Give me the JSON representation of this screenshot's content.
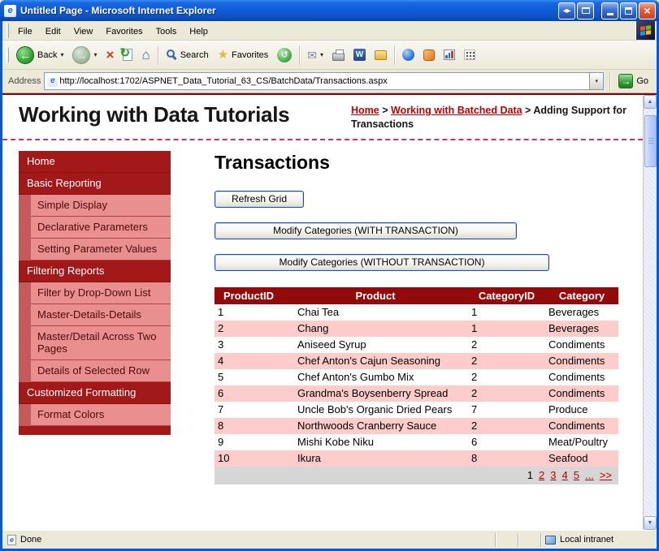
{
  "window": {
    "title": "Untitled Page - Microsoft Internet Explorer",
    "status_left": "Done",
    "status_right": "Local intranet"
  },
  "menu": {
    "items": [
      "File",
      "Edit",
      "View",
      "Favorites",
      "Tools",
      "Help"
    ]
  },
  "toolbar": {
    "back_label": "Back",
    "search_label": "Search",
    "favorites_label": "Favorites",
    "icons": [
      "back",
      "forward",
      "stop",
      "refresh",
      "home",
      "search",
      "favorites",
      "history",
      "mail",
      "print",
      "edit-with-word",
      "discuss",
      "messenger",
      "research",
      "chart",
      "grid"
    ]
  },
  "address_bar": {
    "label": "Address",
    "url": "http://localhost:1702/ASPNET_Data_Tutorial_63_CS/BatchData/Transactions.aspx",
    "go_label": "Go"
  },
  "page": {
    "site_title": "Working with Data Tutorials",
    "breadcrumb": [
      {
        "label": "Home",
        "link": true
      },
      {
        "label": "Working with Batched Data",
        "link": true
      },
      {
        "label": "Adding Support for Transactions",
        "link": false
      }
    ],
    "sidebar": [
      {
        "label": "Home",
        "type": "header"
      },
      {
        "label": "Basic Reporting",
        "type": "header"
      },
      {
        "label": "Simple Display",
        "type": "item"
      },
      {
        "label": "Declarative Parameters",
        "type": "item"
      },
      {
        "label": "Setting Parameter Values",
        "type": "item"
      },
      {
        "label": "Filtering Reports",
        "type": "header"
      },
      {
        "label": "Filter by Drop-Down List",
        "type": "item"
      },
      {
        "label": "Master-Details-Details",
        "type": "item"
      },
      {
        "label": "Master/Detail Across Two Pages",
        "type": "item"
      },
      {
        "label": "Details of Selected Row",
        "type": "item"
      },
      {
        "label": "Customized Formatting",
        "type": "header"
      },
      {
        "label": "Format Colors",
        "type": "item"
      }
    ],
    "main": {
      "title": "Transactions",
      "buttons": {
        "refresh": "Refresh Grid",
        "with_transaction": "Modify Categories (WITH TRANSACTION)",
        "without_transaction": "Modify Categories (WITHOUT TRANSACTION)"
      },
      "table": {
        "columns": [
          "ProductID",
          "Product",
          "CategoryID",
          "Category"
        ],
        "rows": [
          [
            "1",
            "Chai Tea",
            "1",
            "Beverages"
          ],
          [
            "2",
            "Chang",
            "1",
            "Beverages"
          ],
          [
            "3",
            "Aniseed Syrup",
            "2",
            "Condiments"
          ],
          [
            "4",
            "Chef Anton's Cajun Seasoning",
            "2",
            "Condiments"
          ],
          [
            "5",
            "Chef Anton's Gumbo Mix",
            "2",
            "Condiments"
          ],
          [
            "6",
            "Grandma's Boysenberry Spread",
            "2",
            "Condiments"
          ],
          [
            "7",
            "Uncle Bob's Organic Dried Pears",
            "7",
            "Produce"
          ],
          [
            "8",
            "Northwoods Cranberry Sauce",
            "2",
            "Condiments"
          ],
          [
            "9",
            "Mishi Kobe Niku",
            "6",
            "Meat/Poultry"
          ],
          [
            "10",
            "Ikura",
            "8",
            "Seafood"
          ]
        ],
        "pager": {
          "current": "1",
          "pages": [
            "2",
            "3",
            "4",
            "5"
          ],
          "ellipsis": "...",
          "next": ">>"
        }
      }
    }
  },
  "colors": {
    "titlebar_blue": "#0F5BD5",
    "grid_header_red": "#930A0A",
    "sidebar_header_red": "#A31919",
    "sidebar_item_salmon": "#EA8F8F",
    "row_alt_pink": "#FFCCCC",
    "link_red": "#C00000",
    "dashed_rule_pink": "#CC3366",
    "pager_gray": "#D6D6D6"
  }
}
